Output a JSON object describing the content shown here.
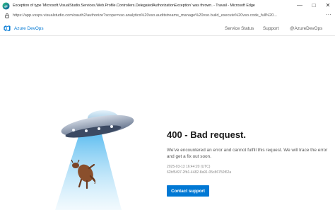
{
  "window": {
    "title": "Exception of type 'Microsoft.VisualStudio.Services.Web.Profile.Controllers.DelegatedAuthorizationException' was thrown. - Travail - Microsoft Edge",
    "controls": {
      "minimize": "—",
      "maximize": "□",
      "close": "✕"
    }
  },
  "browser": {
    "url": "https://app.vssps.visualstudio.com/oauth2/authorize?scope=vso.analytics%20vso.auditstreams_manage%20vso.build_execute%20vso.code_full%20...",
    "more": "···"
  },
  "header": {
    "brand": "Azure DevOps",
    "links": {
      "status": "Service Status",
      "support": "Support",
      "handle": "@AzureDevOps"
    }
  },
  "error": {
    "title": "400 - Bad request.",
    "message": "We've encountered an error and cannot fulfill this request. We will trace the error and get a fix out soon.",
    "timestamp": "2025-03-13 16:44:20 (UTC)",
    "activity_id": "62bf5497-2fb1-4482-8a91-05c86750f62a",
    "button": "Contact support"
  },
  "colors": {
    "accent": "#0078d4",
    "beam": "#6cc4f0"
  },
  "icons": {
    "browser": "edge-icon",
    "secure": "lock-icon",
    "brand": "azure-devops-logo",
    "illustration": "ufo-abduction-illustration"
  }
}
